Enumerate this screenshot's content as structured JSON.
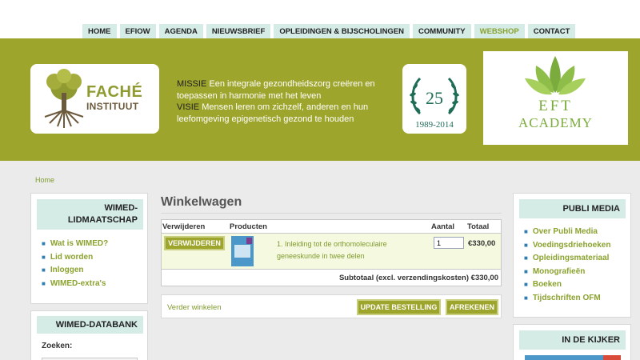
{
  "nav": {
    "items": [
      "HOME",
      "EFIOW",
      "AGENDA",
      "NIEUWSBRIEF",
      "OPLEIDINGEN & BIJSCHOLINGEN",
      "COMMUNITY",
      "WEBSHOP",
      "CONTACT"
    ],
    "active": "WEBSHOP"
  },
  "banner": {
    "logo_name": "FACHÉ",
    "logo_sub": "INSTITUUT",
    "mission_label": "MISSIE",
    "mission_text": "Een integrale gezondheidszorg creëren en toepassen in harmonie met het leven",
    "vision_label": "VISIE",
    "vision_text": "Mensen leren om zichzelf, anderen en hun leefomgeving epigenetisch gezond te houden",
    "anniversary_number": "25",
    "anniversary_years": "1989-2014",
    "eft_title": "EFT",
    "eft_sub": "ACADEMY"
  },
  "breadcrumb": "Home",
  "left_sidebar": {
    "membership_title_1": "WIMED-",
    "membership_title_2": "LIDMAATSCHAP",
    "membership_links": [
      "Wat is WIMED?",
      "Lid worden",
      "Inloggen",
      "WIMED-extra's"
    ],
    "databank_title": "WIMED-DATABANK",
    "search_label": "Zoeken:"
  },
  "right_sidebar": {
    "publi_title": "PUBLI MEDIA",
    "publi_links": [
      "Over Publi Media",
      "Voedingsdriehoeken",
      "Opleidingsmateriaal",
      "Monografieën",
      "Boeken",
      "Tijdschriften OFM"
    ],
    "kijker_title": "IN DE KIJKER"
  },
  "cart": {
    "title": "Winkelwagen",
    "col_remove": "Verwijderen",
    "col_products": "Producten",
    "col_quantity": "Aantal",
    "col_total": "Totaal",
    "remove_label": "VERWIJDEREN",
    "product_name": "1. Inleiding tot de orthomoleculaire geneeskunde in twee delen",
    "quantity": "1",
    "price": "€330,00",
    "subtotal_label": "Subtotaal (excl. verzendingskosten)",
    "subtotal_value": "€330,00",
    "continue_label": "Verder winkelen",
    "update_label": "UPDATE BESTELLING",
    "checkout_label": "AFREKENEN"
  },
  "colors": {
    "brand_olive": "#9ea52c",
    "accent_mint": "#d4ebe6",
    "link_green": "#8aa22e"
  }
}
